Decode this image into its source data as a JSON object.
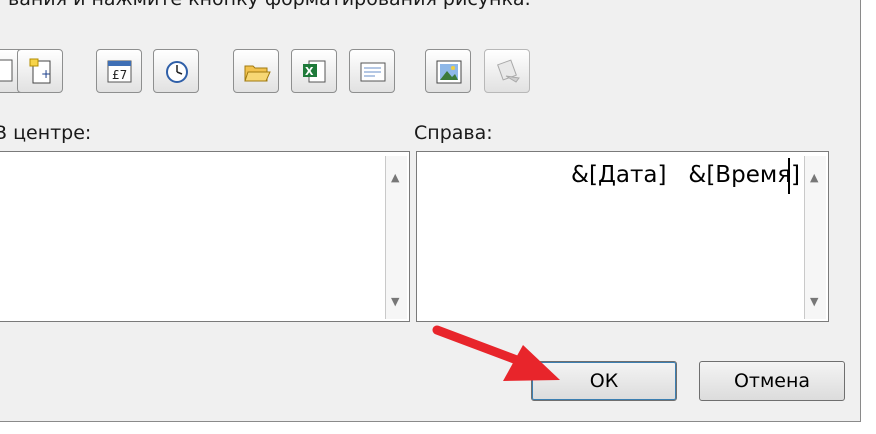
{
  "header": {
    "instruction_text": "вания и нажмите кнопку форматирования рисунка."
  },
  "toolbar": {
    "buttons": [
      {
        "icon": "insert-page-number-icon"
      },
      {
        "icon": "insert-number-of-pages-icon"
      },
      {
        "icon": "insert-date-icon"
      },
      {
        "icon": "insert-time-icon"
      },
      {
        "icon": "insert-file-path-icon"
      },
      {
        "icon": "insert-file-name-icon"
      },
      {
        "icon": "insert-sheet-name-icon"
      },
      {
        "icon": "insert-picture-icon"
      },
      {
        "icon": "format-picture-icon",
        "disabled": true
      }
    ]
  },
  "sections": {
    "center": {
      "label": "В центре:",
      "value": ""
    },
    "right": {
      "label": "Справа:",
      "value": "&[Дата]   &[Время]"
    }
  },
  "buttons": {
    "ok": "ОК",
    "cancel": "Отмена"
  },
  "colors": {
    "dialog_bg": "#f0f0f0",
    "annotation_arrow": "#e8252b"
  }
}
